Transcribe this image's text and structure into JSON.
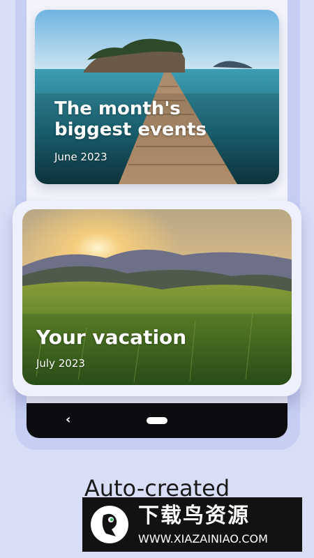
{
  "cards": [
    {
      "title_line1": "The month's",
      "title_line2": "biggest events",
      "date": "June 2023"
    },
    {
      "title_line1": "Your vacation",
      "date": "July 2023"
    }
  ],
  "navbar": {
    "back_glyph": "‹"
  },
  "caption": {
    "line1": "Auto-created",
    "line2": "..."
  },
  "watermark": {
    "title": "下载鸟资源",
    "url": "WWW.XIAZAINIAO.COM"
  },
  "colors": {
    "background": "#d9def7",
    "phone_frame": "#c6cff3",
    "nav_bar": "#0c0c10"
  }
}
